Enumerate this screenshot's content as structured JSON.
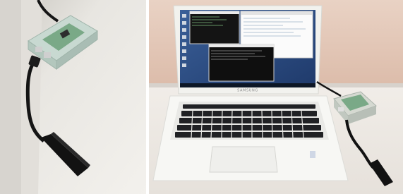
{
  "photos": [
    {
      "id": "left",
      "subject": "raspberry-pi-with-usb-adapter",
      "colors": {
        "background": "#e7e6e2",
        "case": "#b9d0c6",
        "board": "#7aa987",
        "cable": "#121212"
      }
    },
    {
      "id": "right",
      "subject": "laptop-with-raspberry-pi",
      "laptop_brand": "SAMSUNG",
      "colors": {
        "wall": "#e4c9ba",
        "desk": "#efebe4",
        "laptop_body": "#f5f5f1",
        "screen_bg": "#2d4f8a",
        "keys": "#202124"
      }
    }
  ]
}
